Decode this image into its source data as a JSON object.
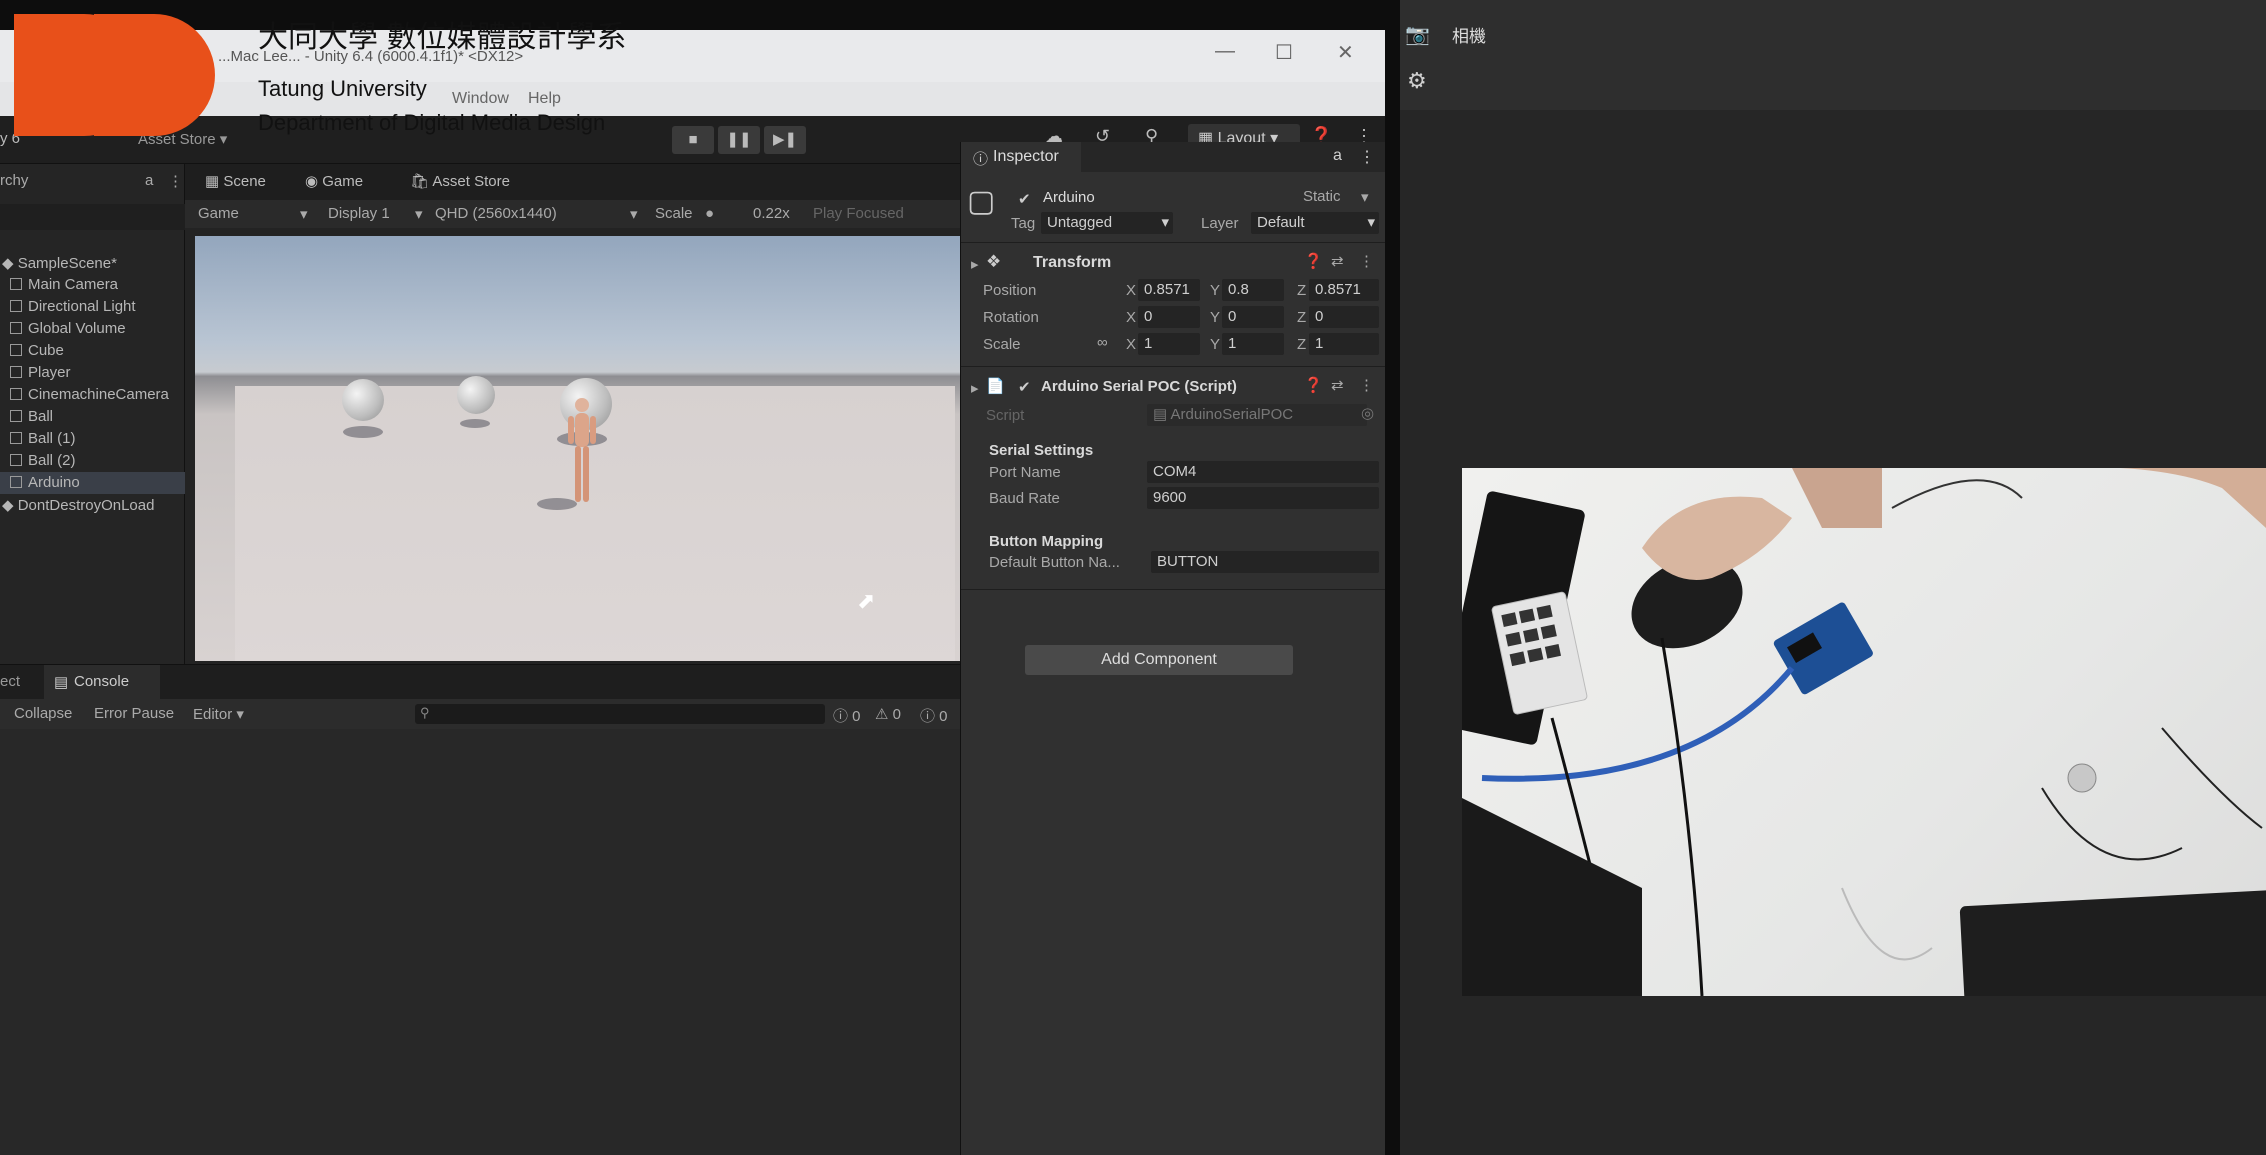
{
  "watermark": {
    "chinese_name": "大同大學 數位媒體設計學系",
    "english_name": "Tatung University",
    "department": "Department of Digital Media Design",
    "brand_color": "#e8501a"
  },
  "window": {
    "title": "...Mac Lee... - Unity 6.4 (6000.4.1f1)* <DX12>",
    "menu_window": "Window",
    "menu_help": "Help",
    "minimize": "—",
    "maximize": "☐",
    "close": "✕"
  },
  "toolbar": {
    "version": "y 6",
    "asset_store": "Asset Store ▾",
    "layout": "Layout ▾",
    "play_icon": "play-icon",
    "pause_icon": "pause-icon",
    "step_icon": "step-icon"
  },
  "hierarchy": {
    "tab": "rchy",
    "lock": "a",
    "items": [
      {
        "label": "SampleScene*"
      },
      {
        "label": "Main Camera"
      },
      {
        "label": "Directional Light"
      },
      {
        "label": "Global Volume"
      },
      {
        "label": "Cube"
      },
      {
        "label": "Player"
      },
      {
        "label": "CinemachineCamera"
      },
      {
        "label": "Ball"
      },
      {
        "label": "Ball (1)"
      },
      {
        "label": "Ball (2)"
      },
      {
        "label": "Arduino"
      },
      {
        "label": "DontDestroyOnLoad"
      }
    ]
  },
  "game_view": {
    "tabs": [
      "Scene",
      "Game",
      "Asset Store"
    ],
    "mode": "Game",
    "display": "Display 1",
    "resolution": "QHD (2560x1440)",
    "scale_label": "Scale",
    "scale_value": "0.22x",
    "play_focused": "Play Focused"
  },
  "console": {
    "tab_left": "ect",
    "tab": "Console",
    "collapse": "Collapse",
    "error_pause": "Error Pause",
    "editor": "Editor ▾",
    "log_count": "0",
    "warn_count": "0",
    "error_count": "0"
  },
  "inspector": {
    "tab": "Inspector",
    "lock": "a",
    "object_name": "Arduino",
    "static_label": "Static",
    "tag_label": "Tag",
    "tag_value": "Untagged",
    "layer_label": "Layer",
    "layer_value": "Default",
    "transform": {
      "title": "Transform",
      "position_label": "Position",
      "rotation_label": "Rotation",
      "scale_label": "Scale",
      "position": {
        "x": "0.8571",
        "y": "0.8",
        "z": "0.8571"
      },
      "rotation": {
        "x": "0",
        "y": "0",
        "z": "0"
      },
      "scale": {
        "x": "1",
        "y": "1",
        "z": "1"
      }
    },
    "script_component": {
      "title": "Arduino Serial POC (Script)",
      "script_label": "Script",
      "script_value": "ArduinoSerialPOC",
      "serial_header": "Serial Settings",
      "port_label": "Port Name",
      "port_value": "COM4",
      "baud_label": "Baud Rate",
      "baud_value": "9600",
      "button_header": "Button Mapping",
      "default_button_label": "Default Button Na...",
      "default_button_value": "BUTTON"
    },
    "add_component": "Add Component"
  },
  "right_panel": {
    "camera_label": "相機",
    "settings_icon": "gear-icon"
  }
}
